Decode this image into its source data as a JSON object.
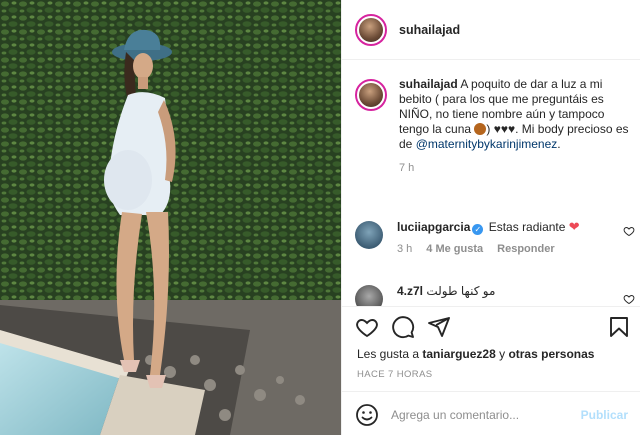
{
  "post": {
    "author": "suhailajad",
    "caption": {
      "user": "suhailajad",
      "text": "A poquito de dar a luz a mi bebito ( para los que me preguntáis es NIÑO, no tiene nombre aún y tampoco tengo la cuna",
      "text_after_emoji": ") ♥♥♥. Mi body precioso es de",
      "mention": "@maternitybykarinjimenez",
      "period": ".",
      "time": "7 h",
      "emoji_icon": "monkey-emoji-icon"
    }
  },
  "comments": [
    {
      "user": "luciiapgarcia",
      "verified": true,
      "text": "Estas radiante",
      "emoji": "❤",
      "time": "3 h",
      "likes": "4 Me gusta",
      "reply": "Responder"
    },
    {
      "user": "4.z7l",
      "text": "مو كنها طولت"
    }
  ],
  "actions": {
    "liked_by_prefix": "Les gusta a",
    "liked_by_user": "taniarguez28",
    "liked_by_conj": "y",
    "liked_by_rest": "otras personas",
    "time_ago": "HACE 7 HORAS"
  },
  "add_comment": {
    "placeholder": "Agrega un comentario...",
    "publish": "Publicar"
  },
  "colors": {
    "accent_blue": "#3897f0",
    "publish_disabled": "#b2dffc",
    "heart_red": "#ed4956",
    "muted": "#8e8e8e"
  }
}
